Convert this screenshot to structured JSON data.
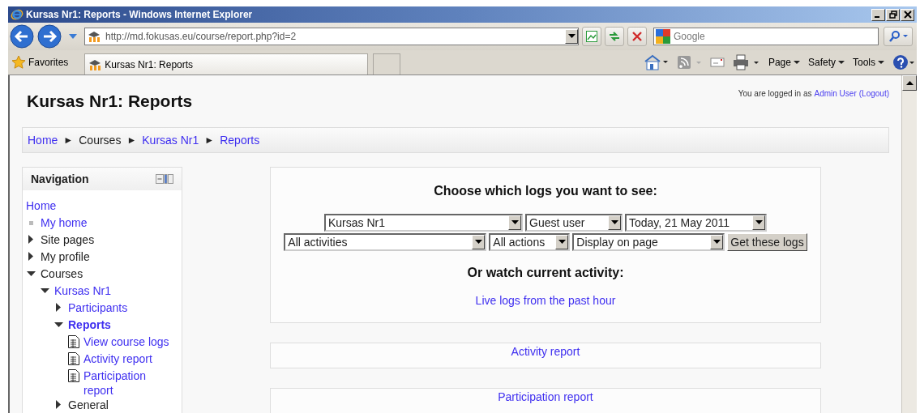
{
  "window": {
    "title": "Kursas Nr1: Reports - Windows Internet Explorer"
  },
  "toolbar": {
    "address": "http://md.fokusas.eu/course/report.php?id=2",
    "search_placeholder": "Google",
    "favorites": "Favorites",
    "tab_title": "Kursas Nr1: Reports",
    "commands": [
      "Page",
      "Safety",
      "Tools"
    ]
  },
  "page": {
    "heading": "Kursas Nr1: Reports",
    "login": {
      "prefix": "You are logged in as",
      "user": "Admin User",
      "logout": "(Logout)"
    },
    "breadcrumb": [
      {
        "label": "Home",
        "link": true
      },
      {
        "label": "Courses",
        "link": false
      },
      {
        "label": "Kursas Nr1",
        "link": true
      },
      {
        "label": "Reports",
        "link": true
      }
    ],
    "breadcrumb_separator": "►",
    "navigation": {
      "title": "Navigation",
      "items": [
        {
          "label": "Home",
          "kind": "plain",
          "link": true,
          "selected": false
        },
        {
          "label": "My home",
          "kind": "leaf",
          "link": true,
          "selected": false
        },
        {
          "label": "Site pages",
          "kind": "branch",
          "link": false,
          "expanded": false,
          "selected": false
        },
        {
          "label": "My profile",
          "kind": "branch",
          "link": false,
          "expanded": false,
          "selected": false
        },
        {
          "label": "Courses",
          "kind": "branch",
          "link": false,
          "expanded": true,
          "selected": false,
          "children": [
            {
              "label": "Kursas Nr1",
              "kind": "branch",
              "link": true,
              "expanded": true,
              "selected": false,
              "children": [
                {
                  "label": "Participants",
                  "kind": "branch",
                  "link": true,
                  "expanded": false,
                  "selected": false
                },
                {
                  "label": "Reports",
                  "kind": "branch",
                  "link": true,
                  "expanded": true,
                  "selected": true,
                  "children": [
                    {
                      "label": "View course logs",
                      "kind": "page",
                      "link": true,
                      "selected": false
                    },
                    {
                      "label": "Activity report",
                      "kind": "page",
                      "link": true,
                      "selected": false
                    },
                    {
                      "label": "Participation report",
                      "kind": "page",
                      "link": true,
                      "selected": false
                    }
                  ]
                },
                {
                  "label": "General",
                  "kind": "branch",
                  "link": false,
                  "expanded": false,
                  "selected": false
                }
              ]
            }
          ]
        }
      ]
    },
    "logs": {
      "heading": "Choose which logs you want to see:",
      "select_rows": [
        [
          "Kursas Nr1",
          "Guest user",
          "Today, 21 May 2011"
        ],
        [
          "All activities",
          "All actions",
          "Display on page"
        ]
      ],
      "button": "Get these logs",
      "subheading": "Or watch current activity:",
      "live_link": "Live logs from the past hour"
    },
    "report_links": [
      "Activity report",
      "Participation report"
    ]
  }
}
